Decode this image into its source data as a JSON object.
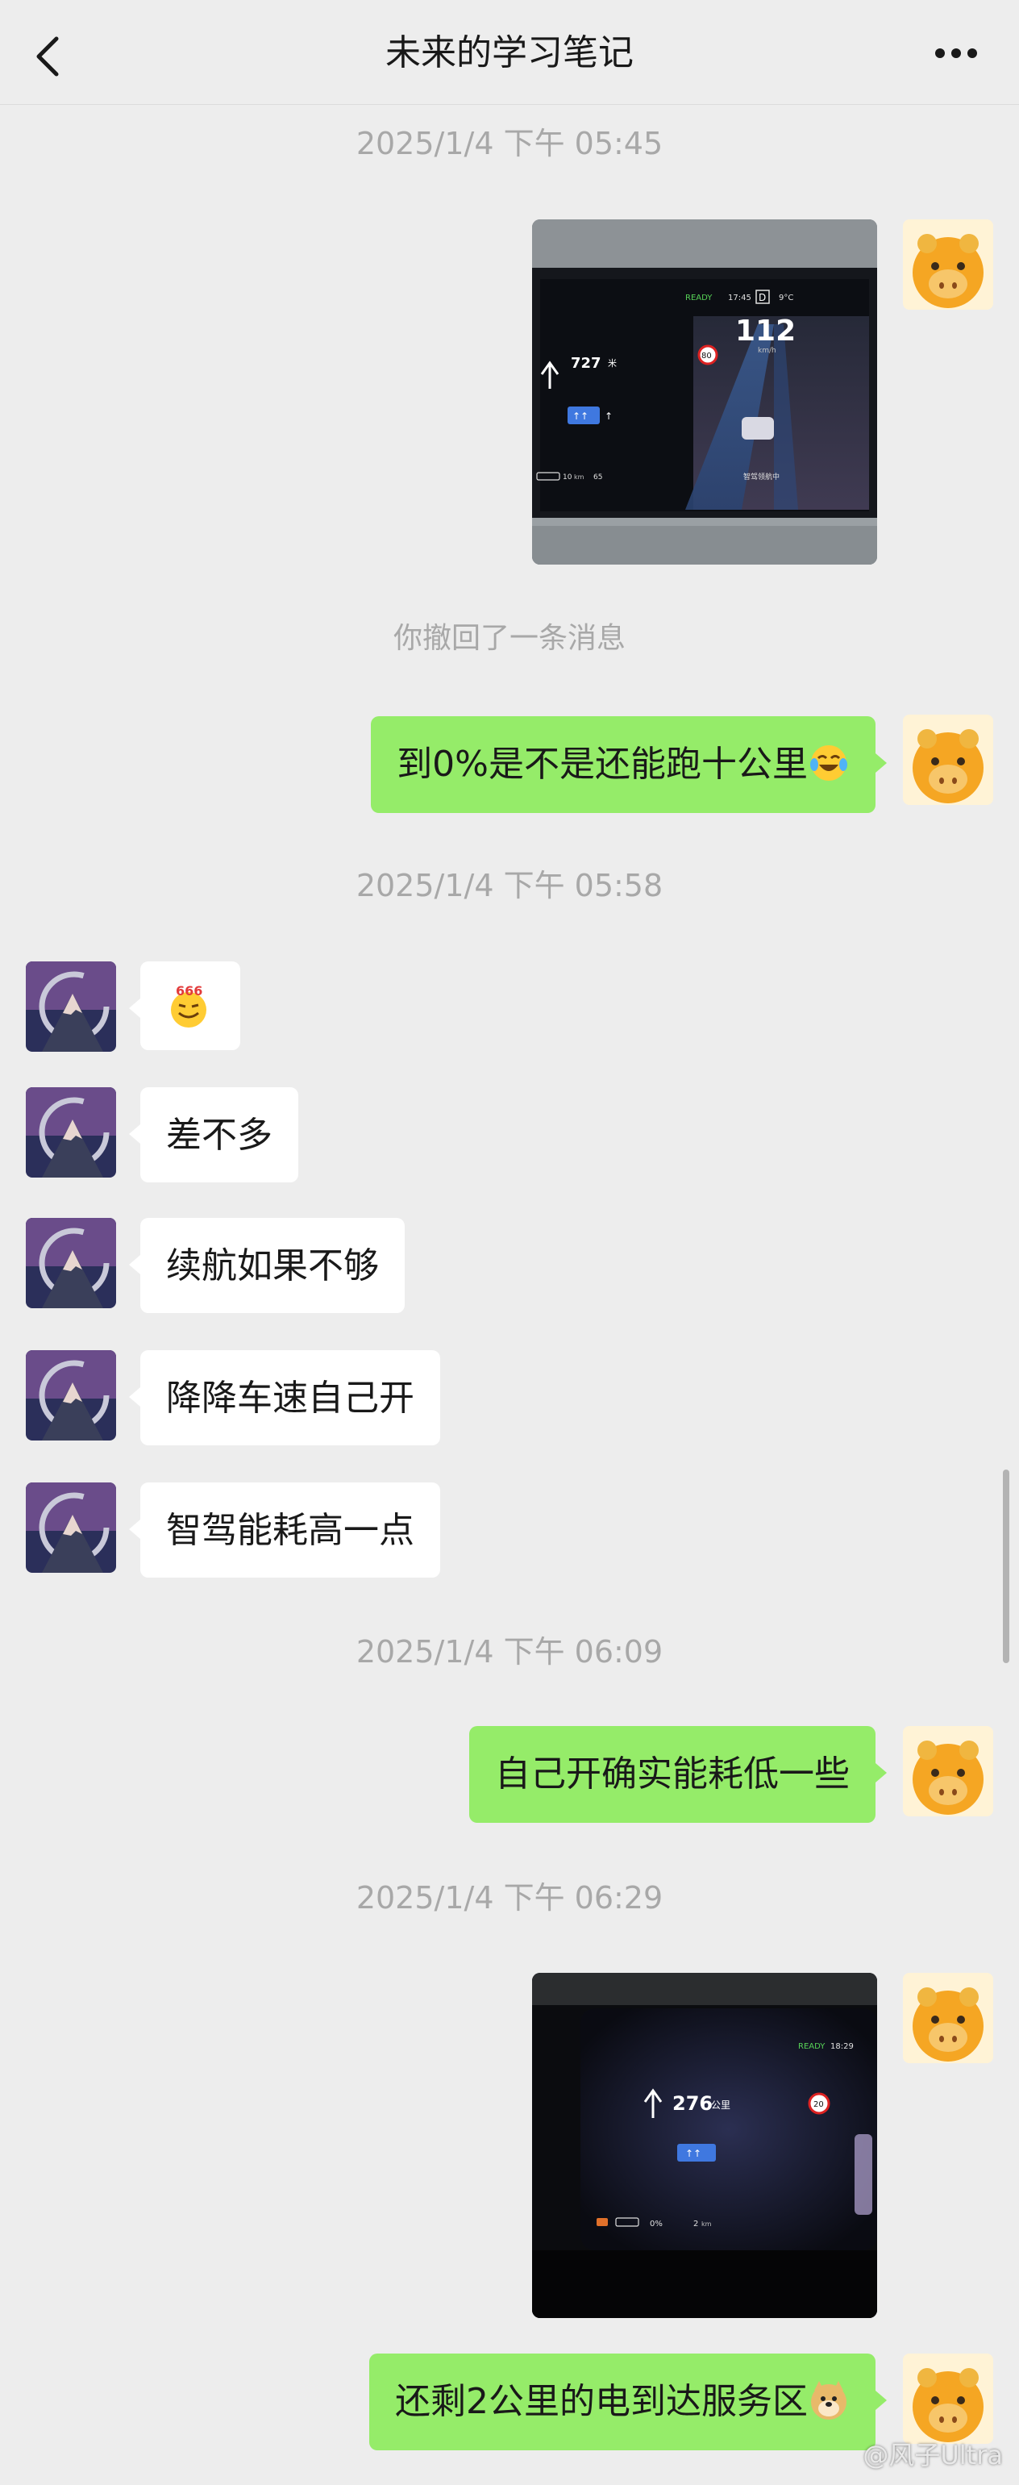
{
  "header": {
    "title": "未来的学习笔记"
  },
  "messages": {
    "t1": "2025/1/4 下午 05:45",
    "recall": "你撤回了一条消息",
    "m2": "到0%是不是还能跑十公里",
    "t2": "2025/1/4 下午 05:58",
    "r1_sticker": "666",
    "r2": "差不多",
    "r3": "续航如果不够",
    "r4": "降降车速自己开",
    "r5": "智驾能耗高一点",
    "t3": "2025/1/4 下午 06:09",
    "m3": "自己开确实能耗低一些",
    "t4": "2025/1/4 下午 06:29",
    "m5": "还剩2公里的电到达服务区"
  },
  "photo1": {
    "ready": "READY",
    "clock": "17:45",
    "gear": "D",
    "temp": "9°C",
    "speed": "112",
    "speed_unit": "km/h",
    "limit": "80",
    "distance": "727",
    "distance_unit": "米",
    "range": "10",
    "range_unit": "km",
    "consumption": "65",
    "mode": "智驾领航中"
  },
  "photo2": {
    "ready": "READY",
    "clock": "18:29",
    "distance": "276",
    "distance_unit": "公里",
    "limit": "20",
    "battery": "0%",
    "range": "2",
    "range_unit": "km"
  },
  "watermark": "@风子Ultra",
  "icons": {
    "back": "chevron-left-icon",
    "more": "more-dots-icon",
    "laugh": "tears-of-joy-emoji",
    "dog": "doge-emoji",
    "sticker": "666-emoji"
  },
  "colors": {
    "background": "#ededed",
    "my_bubble": "#95ec69",
    "their_bubble": "#ffffff",
    "timestamp": "#a8a8a8"
  }
}
